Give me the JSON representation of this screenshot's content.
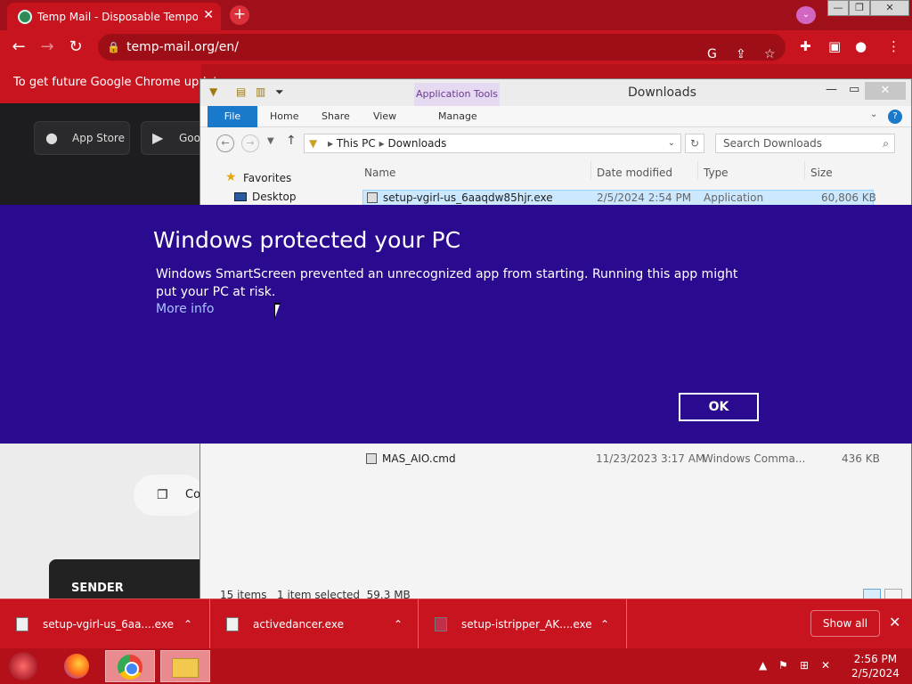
{
  "chrome": {
    "tab_title": "Temp Mail - Disposable Tempora",
    "url": "temp-mail.org/en/",
    "update_banner": "To get future Google Chrome update"
  },
  "page": {
    "app_store_label": "App Store",
    "google_play_label": "Goo",
    "copy_label": "Co",
    "sender_header": "SENDER"
  },
  "explorer": {
    "title": "Downloads",
    "app_tools_label": "Application Tools",
    "ribbon_tabs": [
      "File",
      "Home",
      "Share",
      "View",
      "Manage"
    ],
    "breadcrumb": [
      "This PC",
      "Downloads"
    ],
    "search_placeholder": "Search Downloads",
    "nav": {
      "favorites": "Favorites",
      "desktop": "Desktop"
    },
    "columns": [
      "Name",
      "Date modified",
      "Type",
      "Size"
    ],
    "files": [
      {
        "name": "setup-vgirl-us_6aaqdw85hjr.exe",
        "date": "2/5/2024 2:54 PM",
        "type": "Application",
        "size": "60,806 KB"
      },
      {
        "name": "MAS_AIO.cmd",
        "date": "11/23/2023 3:17 AM",
        "type": "Windows Comma...",
        "size": "436 KB"
      }
    ],
    "status": {
      "items": "15 items",
      "selected": "1 item selected  59.3 MB"
    }
  },
  "smartscreen": {
    "title": "Windows protected your PC",
    "body": "Windows SmartScreen prevented an unrecognized app from starting. Running this app might put your PC at risk.",
    "more_info": "More info",
    "ok": "OK"
  },
  "downloads_shelf": {
    "items": [
      "setup-vgirl-us_6aa....exe",
      "activedancer.exe",
      "setup-istripper_AK....exe"
    ],
    "show_all": "Show all"
  },
  "taskbar": {
    "time": "2:56 PM",
    "date": "2/5/2024"
  }
}
